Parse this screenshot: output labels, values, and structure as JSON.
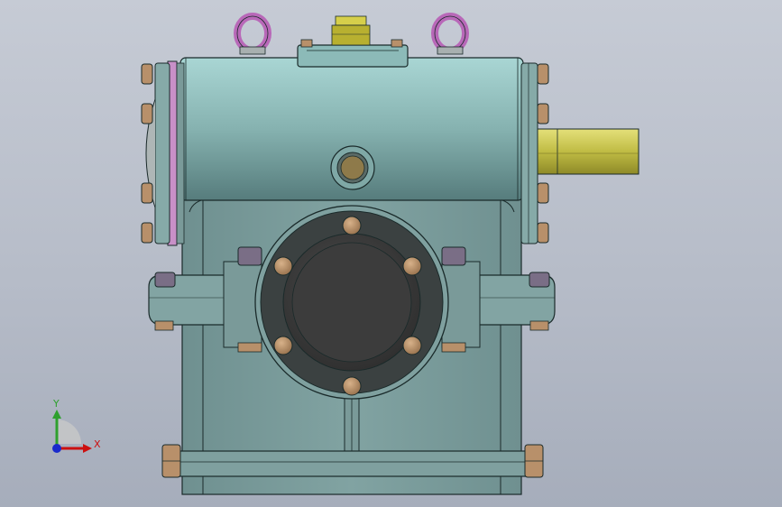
{
  "viewport": {
    "background_top": "#c6cbd5",
    "background_bottom": "#a6adbb"
  },
  "model": {
    "name": "worm-gear-reducer",
    "view": "front",
    "colors": {
      "housing": "#7a9a99",
      "housing_light": "#a8d4d2",
      "housing_dark": "#4e7474",
      "outline": "#1a2a2a",
      "bolt": "#b8906a",
      "nut": "#7a6e86",
      "eye_bolt": "#b868b8",
      "shaft": "#c8c452",
      "breather": "#b8b030",
      "bearing_cap": "#3d3d3d",
      "gasket": "#c890c8"
    }
  },
  "triad": {
    "y_label": "Y",
    "x_label": "X",
    "y_color": "#2ea02e",
    "x_color": "#cc1010",
    "origin_color": "#1a2acc"
  }
}
